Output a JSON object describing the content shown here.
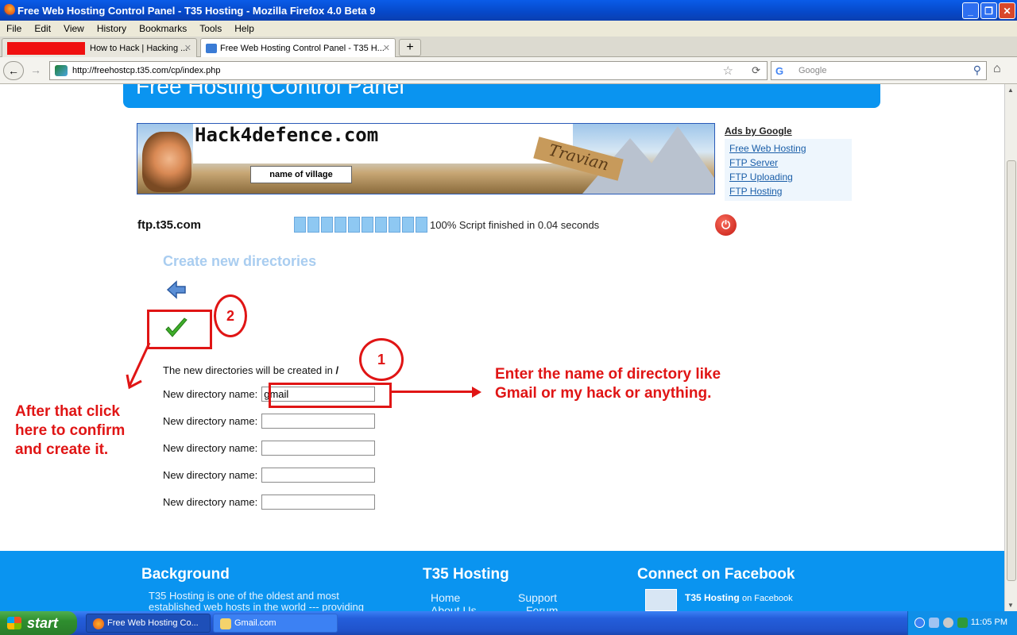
{
  "window": {
    "title": "Free Web Hosting Control Panel - T35 Hosting - Mozilla Firefox 4.0 Beta 9"
  },
  "menu": [
    "File",
    "Edit",
    "View",
    "History",
    "Bookmarks",
    "Tools",
    "Help"
  ],
  "tabs": [
    {
      "label": "How to Hack | Hacking ...",
      "active": false
    },
    {
      "label": "Free Web Hosting Control Panel - T35 H...",
      "active": true
    }
  ],
  "nav": {
    "url": "http://freehostcp.t35.com/cp/index.php",
    "search_placeholder": "Google"
  },
  "page": {
    "banner_title": "Free Hosting Control Panel",
    "ad_banner": {
      "headline": "Hack4defence.com",
      "village_label": "name of village",
      "sign_text": "Travian"
    },
    "ads": {
      "heading": "Ads by Google",
      "links": [
        "Free Web Hosting",
        "FTP Server",
        "FTP Uploading",
        "FTP Hosting"
      ]
    },
    "server": "ftp.t35.com",
    "progress": {
      "percent": 100,
      "segments": 10,
      "text": "100% Script finished in 0.04 seconds"
    },
    "section_title": "Create new directories",
    "info_text": "The new directories will be created in",
    "info_path": "/",
    "field_label": "New directory name:",
    "fields": [
      "gmail",
      "",
      "",
      "",
      ""
    ]
  },
  "annotations": {
    "step1": "1",
    "step2": "2",
    "note_right_1": "Enter the name of directory like",
    "note_right_2": "Gmail or my hack or anything.",
    "note_left_1": "After that click",
    "note_left_2": "here to confirm",
    "note_left_3": "and create it."
  },
  "footer": {
    "col1_title": "Background",
    "col1_text_1": "T35 Hosting is one of the oldest and most",
    "col1_text_2": "established web hosts in the world --- providing",
    "col2_title": "T35 Hosting",
    "col2_links": [
      "Home",
      "Support",
      "About Us",
      "Forum"
    ],
    "col3_title": "Connect on Facebook",
    "col3_name": "T35 Hosting",
    "col3_suffix": "on Facebook"
  },
  "taskbar": {
    "start": "start",
    "tasks": [
      "Free Web Hosting Co...",
      "Gmail.com"
    ],
    "clock": "11:05 PM"
  },
  "colors": {
    "annotation_red": "#e01515",
    "brand_blue": "#0a94f0",
    "heading_blue": "#a9cdf0"
  }
}
